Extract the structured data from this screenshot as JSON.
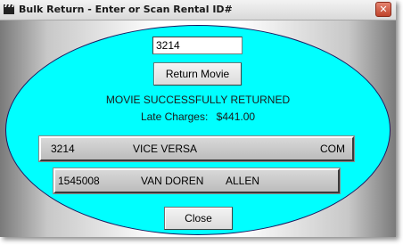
{
  "window": {
    "title": "Bulk Return - Enter or Scan Rental ID#",
    "close_glyph": "✕"
  },
  "rental_input": {
    "value": "3214"
  },
  "buttons": {
    "return_label": "Return Movie",
    "close_label": "Close"
  },
  "status": {
    "message": "MOVIE SUCCESSFULLY RETURNED",
    "late_charges_label": "Late Charges:",
    "late_charges_value": "$441.00"
  },
  "movie": {
    "id": "3214",
    "title": "VICE VERSA",
    "genre": "COM"
  },
  "customer": {
    "id": "1545008",
    "last_name": "VAN DOREN",
    "first_name": "ALLEN"
  },
  "colors": {
    "ellipse_fill": "#00ffff",
    "close_button": "#c0442c"
  },
  "icons": {
    "app": "clapperboard-icon",
    "close": "close-icon"
  }
}
